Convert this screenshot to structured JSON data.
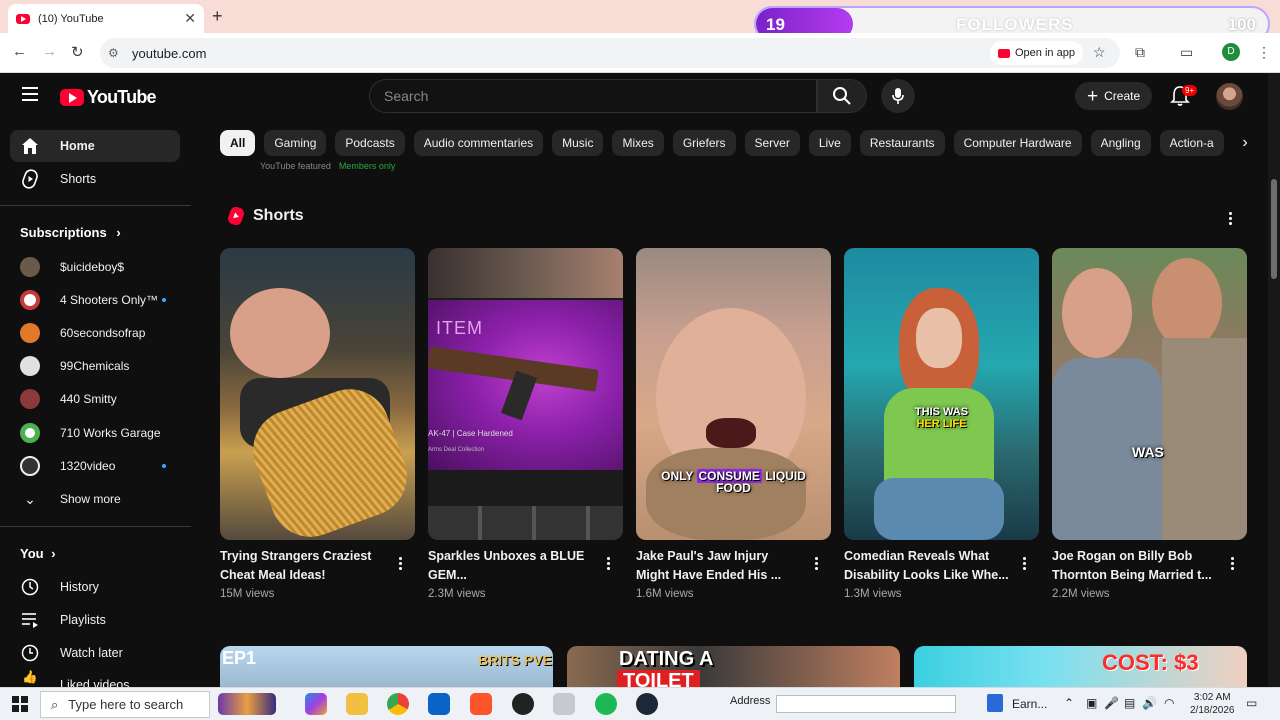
{
  "browser": {
    "tab_title": "(10) YouTube",
    "url": "youtube.com",
    "open_in_app": "Open in app",
    "profile_initial": "D"
  },
  "overlay_widget": {
    "current": "19",
    "label": "FOLLOWERS",
    "goal": "100",
    "progress_fraction": 0.19
  },
  "masthead": {
    "logo_text": "YouTube",
    "search_placeholder": "Search",
    "create_label": "Create",
    "notification_count": "9+"
  },
  "sidebar": {
    "primary": [
      {
        "label": "Home",
        "icon": "home-icon"
      },
      {
        "label": "Shorts",
        "icon": "shorts-icon"
      }
    ],
    "subscriptions_heading": "Subscriptions",
    "subscriptions": [
      {
        "name": "$uicideboy$",
        "new": false,
        "color": "#6a5a4a"
      },
      {
        "name": "4 Shooters Only™",
        "new": true,
        "color": "#c83a3a"
      },
      {
        "name": "60secondsofrap",
        "new": false,
        "color": "#e07a2a"
      },
      {
        "name": "99Chemicals",
        "new": false,
        "color": "#e0e0e0"
      },
      {
        "name": "440 Smitty",
        "new": false,
        "color": "#8a3a3a"
      },
      {
        "name": "710 Works Garage",
        "new": false,
        "color": "#4caf50"
      },
      {
        "name": "1320video",
        "new": true,
        "color": "#333333"
      }
    ],
    "show_more": "Show more",
    "you_heading": "You",
    "you_items": [
      {
        "label": "History",
        "icon": "history-icon"
      },
      {
        "label": "Playlists",
        "icon": "playlists-icon"
      },
      {
        "label": "Watch later",
        "icon": "watch-later-icon"
      },
      {
        "label": "Liked videos",
        "icon": "liked-icon"
      }
    ]
  },
  "chips": [
    "All",
    "Gaming",
    "Podcasts",
    "Audio commentaries",
    "Music",
    "Mixes",
    "Griefers",
    "Server",
    "Live",
    "Restaurants",
    "Computer Hardware",
    "Angling",
    "Action-a"
  ],
  "faded_row": {
    "channel": "YouTube featured",
    "badge": "Members only"
  },
  "shorts": {
    "heading": "Shorts",
    "items": [
      {
        "title": "Trying Strangers Craziest Cheat Meal Ideas!",
        "title_line1": "Trying Strangers Craziest",
        "title_line2": "Cheat Meal Ideas!",
        "views": "15M views"
      },
      {
        "title": "Sparkles Unboxes a BLUE GEM...",
        "title_line1": "Sparkles Unboxes a BLUE",
        "title_line2": "GEM...",
        "views": "2.3M views",
        "thumb_text": "ITEM",
        "thumb_sub": "AK-47 | Case Hardened",
        "thumb_sub2": "Arms Deal Collection"
      },
      {
        "title": "Jake Paul's Jaw Injury Might Have Ended His ...",
        "title_line1": "Jake Paul's Jaw Injury",
        "title_line2": "Might Have Ended His ...",
        "views": "1.6M views",
        "thumb_a": "ONLY",
        "thumb_b": "CONSUME",
        "thumb_c": "LIQUID",
        "thumb_d": "FOOD"
      },
      {
        "title": "Comedian Reveals What Disability Looks Like Whe...",
        "title_line1": "Comedian Reveals What",
        "title_line2": "Disability Looks Like Whe...",
        "views": "1.3M views",
        "thumb_a": "THIS WAS",
        "thumb_b": "HER LIFE"
      },
      {
        "title": "Joe Rogan on Billy Bob Thornton Being Married t...",
        "title_line1": "Joe Rogan on Billy Bob",
        "title_line2": "Thornton Being Married t...",
        "views": "2.2M views",
        "thumb_a": "WAS"
      }
    ]
  },
  "bottom_row": {
    "ep_label": "EP1",
    "brits_label": "BRITS PVE",
    "dating_label": "DATING A",
    "toilet_label": "TOILET",
    "cost_label": "COST: $3"
  },
  "taskbar": {
    "search_placeholder": "Type here to search",
    "address_label": "Address",
    "earn_label": "Earn...",
    "time": "3:02 AM",
    "date": "2/18/2026"
  }
}
